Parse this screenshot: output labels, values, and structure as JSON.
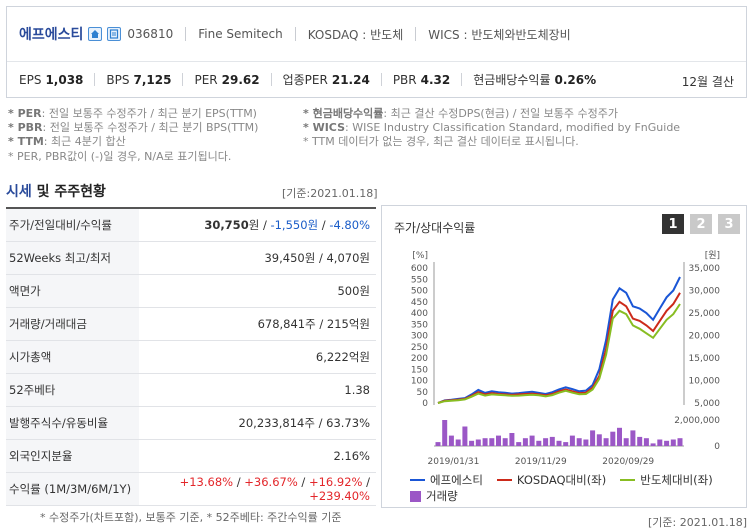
{
  "header": {
    "company_name": "에프에스티",
    "stock_code": "036810",
    "english_name": "Fine Semitech",
    "market": "KOSDAQ : 반도체",
    "wics": "WICS : 반도체와반도체장비",
    "metrics": [
      {
        "label": "EPS",
        "value": "1,038"
      },
      {
        "label": "BPS",
        "value": "7,125"
      },
      {
        "label": "PER",
        "value": "29.62"
      },
      {
        "label": "업종PER",
        "value": "21.24"
      },
      {
        "label": "PBR",
        "value": "4.32"
      },
      {
        "label": "현금배당수익률",
        "value": "0.26%"
      }
    ],
    "settlement": "12월 결산",
    "icons": [
      "home-icon",
      "report-icon"
    ]
  },
  "notes": {
    "left": [
      {
        "key": "* PER",
        "text": ": 전일 보통주 수정주가 / 최근 분기 EPS(TTM)"
      },
      {
        "key": "* PBR",
        "text": ": 전일 보통주 수정주가 / 최근 분기 BPS(TTM)"
      },
      {
        "key": "* TTM",
        "text": ": 최근 4분기 합산"
      },
      {
        "key": "",
        "text": "* PER, PBR값이 (-)일 경우, N/A로 표기됩니다."
      }
    ],
    "right": [
      {
        "key": "* 현금배당수익률",
        "text": ": 최근 결산 수정DPS(현금) / 전일 보통주 수정주가"
      },
      {
        "key": "* WICS",
        "text": ": WISE Industry Classification Standard, modified by FnGuide"
      },
      {
        "key": "",
        "text": "* TTM 데이터가 없는 경우, 최근 결산 데이터로 표시됩니다."
      }
    ]
  },
  "section": {
    "title_a": "시세",
    "title_b": " 및 주주현황",
    "date": "[기준:2021.01.18]"
  },
  "table": [
    {
      "label": "주가/전일대비/수익률",
      "parts": [
        {
          "t": "30,750",
          "c": "bold"
        },
        {
          "t": "원 / ",
          "c": ""
        },
        {
          "t": "-1,550원",
          "c": "blue"
        },
        {
          "t": " / ",
          "c": ""
        },
        {
          "t": "-4.80%",
          "c": "blue"
        }
      ]
    },
    {
      "label": "52Weeks 최고/최저",
      "parts": [
        {
          "t": "39,450원 / 4,070원",
          "c": ""
        }
      ]
    },
    {
      "label": "액면가",
      "parts": [
        {
          "t": "500원",
          "c": ""
        }
      ]
    },
    {
      "label": "거래량/거래대금",
      "parts": [
        {
          "t": "678,841주 / 215억원",
          "c": ""
        }
      ]
    },
    {
      "label": "시가총액",
      "parts": [
        {
          "t": "6,222억원",
          "c": ""
        }
      ]
    },
    {
      "label": "52주베타",
      "parts": [
        {
          "t": "1.38",
          "c": ""
        }
      ]
    },
    {
      "label": "발행주식수/유동비율",
      "parts": [
        {
          "t": "20,233,814주 / 63.73%",
          "c": ""
        }
      ]
    },
    {
      "label": "외국인지분율",
      "parts": [
        {
          "t": "2.16%",
          "c": ""
        }
      ]
    },
    {
      "label": "수익률 (1M/3M/6M/1Y)",
      "parts": [
        {
          "t": "+13.68%",
          "c": "red"
        },
        {
          "t": " / ",
          "c": ""
        },
        {
          "t": "+36.67%",
          "c": "red"
        },
        {
          "t": " / ",
          "c": ""
        },
        {
          "t": "+16.92%",
          "c": "red"
        },
        {
          "t": " / ",
          "c": ""
        },
        {
          "t": "+239.40%",
          "c": "red"
        }
      ]
    }
  ],
  "footnote": "* 수정주가(차트포함), 보통주 기준, * 52주베타: 주간수익률 기준",
  "footnote_date": "[기준: 2021.01.18]",
  "chart_panel": {
    "title": "주가/상대수익률",
    "pages": [
      "1",
      "2",
      "3"
    ],
    "active_page": 0
  },
  "chart_data": {
    "type": "line",
    "left_axis_unit": "[%]",
    "right_axis_unit": "[원]",
    "left_ticks": [
      "0",
      "50",
      "100",
      "150",
      "200",
      "250",
      "300",
      "350",
      "400",
      "450",
      "500",
      "550",
      "600"
    ],
    "right_ticks": [
      "5,000",
      "10,000",
      "15,000",
      "20,000",
      "25,000",
      "30,000",
      "35,000"
    ],
    "volume_ticks": [
      "0",
      "2,000,000"
    ],
    "x_labels": [
      "2019/01/31",
      "2019/11/29",
      "2020/09/29"
    ],
    "ylim_left": [
      0,
      600
    ],
    "ylim_right": [
      5000,
      35000
    ],
    "series": [
      {
        "name": "에프에스티",
        "color": "#1a56d6",
        "values": [
          0,
          12,
          14,
          18,
          22,
          38,
          58,
          45,
          52,
          48,
          46,
          42,
          44,
          47,
          50,
          45,
          40,
          48,
          60,
          70,
          62,
          52,
          55,
          80,
          150,
          280,
          460,
          510,
          490,
          430,
          420,
          400,
          370,
          420,
          470,
          500,
          560
        ]
      },
      {
        "name": "KOSDAQ대비(좌)",
        "color": "#cc2a1a",
        "values": [
          0,
          10,
          12,
          15,
          18,
          32,
          48,
          38,
          44,
          40,
          38,
          36,
          38,
          40,
          42,
          38,
          34,
          40,
          52,
          60,
          52,
          44,
          46,
          68,
          120,
          240,
          410,
          450,
          430,
          375,
          365,
          345,
          320,
          365,
          410,
          440,
          490
        ]
      },
      {
        "name": "반도체대비(좌)",
        "color": "#88bd22",
        "values": [
          0,
          8,
          10,
          12,
          16,
          28,
          42,
          33,
          38,
          36,
          34,
          32,
          33,
          35,
          37,
          34,
          30,
          35,
          46,
          54,
          46,
          39,
          40,
          60,
          108,
          215,
          375,
          410,
          395,
          345,
          330,
          310,
          290,
          330,
          370,
          395,
          440
        ]
      }
    ],
    "volume": {
      "name": "거래량",
      "color": "#9b57c6",
      "values": [
        0.15,
        1.0,
        0.4,
        0.25,
        0.75,
        0.2,
        0.25,
        0.3,
        0.3,
        0.4,
        0.3,
        0.5,
        0.15,
        0.3,
        0.4,
        0.2,
        0.3,
        0.35,
        0.2,
        0.15,
        0.4,
        0.3,
        0.25,
        0.6,
        0.45,
        0.3,
        0.55,
        0.7,
        0.3,
        0.6,
        0.35,
        0.3,
        0.1,
        0.25,
        0.2,
        0.25,
        0.3
      ]
    },
    "legend": [
      {
        "name": "에프에스티",
        "color": "#1a56d6",
        "kind": "line"
      },
      {
        "name": "KOSDAQ대비(좌)",
        "color": "#cc2a1a",
        "kind": "line"
      },
      {
        "name": "반도체대비(좌)",
        "color": "#88bd22",
        "kind": "line"
      },
      {
        "name": "거래량",
        "color": "#9b57c6",
        "kind": "box"
      }
    ]
  }
}
